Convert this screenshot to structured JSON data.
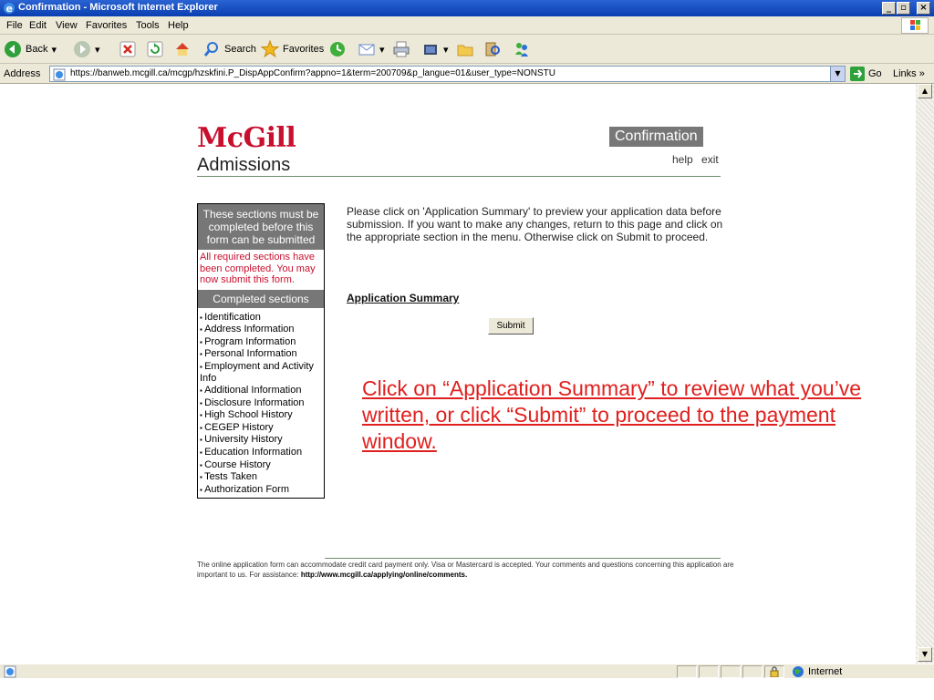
{
  "window": {
    "title": "Confirmation - Microsoft Internet Explorer",
    "controls": [
      "_",
      "▫",
      "×"
    ]
  },
  "menubar": {
    "items": [
      "File",
      "Edit",
      "View",
      "Favorites",
      "Tools",
      "Help"
    ]
  },
  "toolbar": {
    "back_label": "Back",
    "search_label": "Search",
    "favorites_label": "Favorites"
  },
  "addressbar": {
    "label": "Address",
    "url": "https://banweb.mcgill.ca/mcgp/hzskfini.P_DispAppConfirm?appno=1&term=200709&p_langue=01&user_type=NONSTU",
    "go_label": "Go",
    "links_label": "Links »"
  },
  "page": {
    "logo_name": "McGill",
    "logo_sub": "Admissions",
    "title": "Confirmation",
    "help_label": "help",
    "exit_label": "exit",
    "sidebar": {
      "required_header": "These sections must be completed before this form can be submitted",
      "status_text": "All required sections have been completed. You may now submit this form.",
      "completed_header": "Completed sections",
      "sections": [
        "Identification",
        "Address Information",
        "Program Information",
        "Personal Information",
        "Employment and Activity Info",
        "Additional Information",
        "Disclosure Information",
        "High School History",
        "CEGEP History",
        "University History",
        "Education Information",
        "Course History",
        "Tests Taken",
        "Authorization Form"
      ]
    },
    "intro_text": "Please click on 'Application Summary' to preview your application data before submission. If you want to make any changes, return to this page and click on the appropriate section in the menu. Otherwise click on Submit to proceed.",
    "summary_link": "Application Summary",
    "submit_label": "Submit",
    "annotation": "Click on “Application Summary” to review what you’ve written, or click “Submit” to proceed to the payment window.",
    "footer_text": "The online application form can accommodate credit card payment only. Visa or Mastercard is accepted. Your comments and questions concerning this application are important to us. For assistance: ",
    "footer_link": "http://www.mcgill.ca/applying/online/comments."
  },
  "statusbar": {
    "zone": "Internet"
  },
  "colors": {
    "mcgill_red": "#c8102e",
    "annotation_red": "#e0201e",
    "header_gray": "#777777",
    "chrome": "#ece9d8",
    "titlebar_blue": "#0a3fb0"
  }
}
